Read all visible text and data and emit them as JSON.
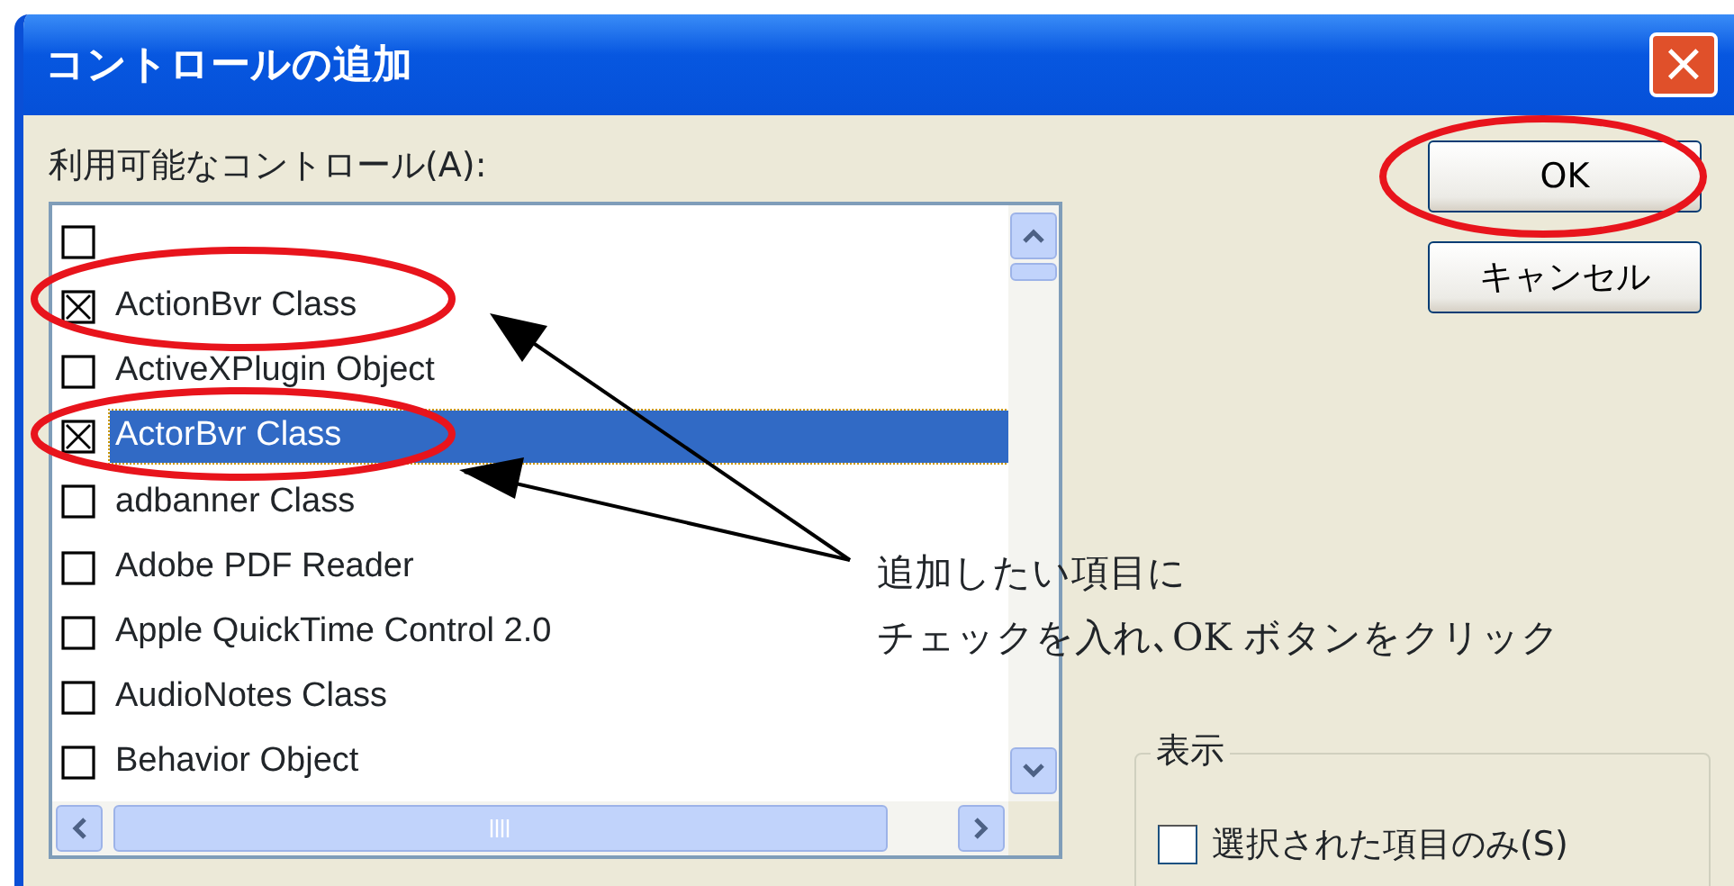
{
  "window": {
    "title": "コントロールの追加",
    "close": "×"
  },
  "list_label": "利用可能なコントロール(A):",
  "items": [
    {
      "checked": false,
      "selected": false
    },
    {
      "label": "ActionBvr Class",
      "checked": true,
      "selected": false
    },
    {
      "label": "ActiveXPlugin Object",
      "checked": false,
      "selected": false
    },
    {
      "label": "ActorBvr Class",
      "checked": true,
      "selected": true
    },
    {
      "label": "adbanner Class",
      "checked": false,
      "selected": false
    },
    {
      "label": "Adobe PDF Reader",
      "checked": false,
      "selected": false
    },
    {
      "label": "Apple QuickTime Control 2.0",
      "checked": false,
      "selected": false
    },
    {
      "label": "AudioNotes Class",
      "checked": false,
      "selected": false
    },
    {
      "label": "Behavior Object",
      "checked": false,
      "selected": false
    }
  ],
  "buttons": [
    "OK",
    "キャンセル"
  ],
  "display_group": {
    "title": "表示",
    "option": {
      "label": "選択された項目のみ(S)",
      "checked": false
    }
  },
  "callout": {
    "lines": [
      "追加したい項目に",
      "チェックを入れ､OK ボタンをクリック"
    ]
  }
}
